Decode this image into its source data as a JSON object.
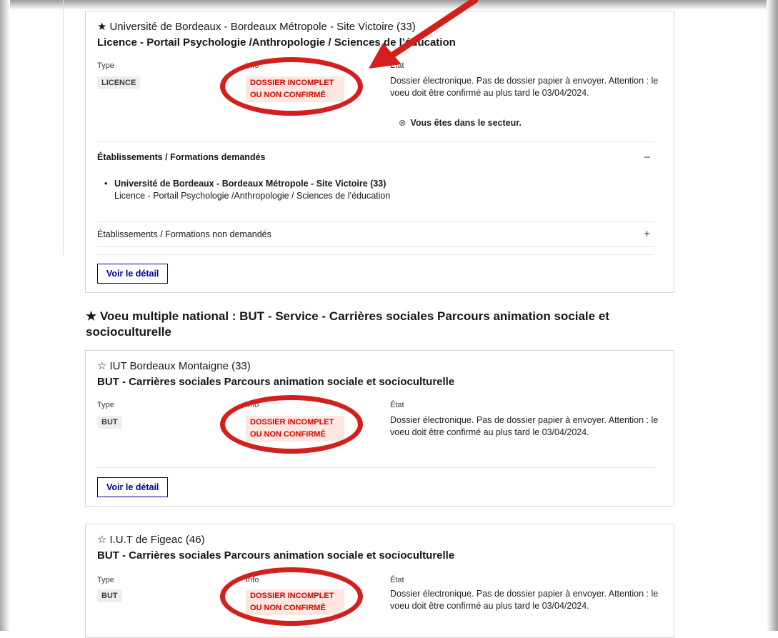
{
  "card1": {
    "school": "Université de Bordeaux - Bordeaux Métropole - Site Victoire  (33)",
    "school_star": "★",
    "formation": "Licence - Portail Psychologie /Anthropologie / Sciences de l’éducation",
    "type_label": "Type",
    "type_value": "LICENCE",
    "info_label": "Info",
    "info_line1": "DOSSIER INCOMPLET",
    "info_line2": "OU NON CONFIRMÉ",
    "etat_label": "État",
    "etat_text": "Dossier électronique. Pas de dossier papier à envoyer. Attention : le voeu doit être confirmé au plus tard le 03/04/2024.",
    "sector_icon": "⊗",
    "sector_text": "Vous êtes dans le secteur.",
    "accordion1_title": "Établissements / Formations demandés",
    "accordion1_toggle": "–",
    "requested_item_bullet": "•",
    "requested_item_school": "Université de Bordeaux - Bordeaux Métropole - Site Victoire (33)",
    "requested_item_formation": "Licence - Portail Psychologie /Anthropologie / Sciences de l’éducation",
    "accordion2_title": "Établissements / Formations non demandés",
    "accordion2_toggle": "+",
    "detail_button": "Voir le détail"
  },
  "group": {
    "title": "★ Voeu multiple national : BUT - Service - Carrières sociales Parcours animation sociale et socioculturelle"
  },
  "card2": {
    "school": "IUT Bordeaux Montaigne  (33)",
    "school_star": "☆",
    "formation": "BUT - Carrières sociales Parcours animation sociale et socioculturelle",
    "type_label": "Type",
    "type_value": "BUT",
    "info_label": "Info",
    "info_line1": "DOSSIER INCOMPLET",
    "info_line2": "OU NON CONFIRMÉ",
    "etat_label": "État",
    "etat_text": "Dossier électronique. Pas de dossier papier à envoyer. Attention : le voeu doit être confirmé au plus tard le 03/04/2024.",
    "detail_button": "Voir le détail"
  },
  "card3": {
    "school": "I.U.T de Figeac  (46)",
    "school_star": "☆",
    "formation": "BUT - Carrières sociales Parcours animation sociale et socioculturelle",
    "type_label": "Type",
    "type_value": "BUT",
    "info_label": "Info",
    "info_line1": "DOSSIER INCOMPLET",
    "info_line2": "OU NON CONFIRMÉ",
    "etat_label": "État",
    "etat_text": "Dossier électronique. Pas de dossier papier à envoyer. Attention : le voeu doit être confirmé au plus tard le 03/04/2024."
  },
  "colors": {
    "annotation_red": "#d3201d",
    "badge_red_text": "#ce0500",
    "badge_red_bg": "#fee7e0",
    "button_blue": "#000091"
  },
  "icons": {
    "annotation_arrow": "red-arrow-icon",
    "sector": "circle-x-icon"
  }
}
